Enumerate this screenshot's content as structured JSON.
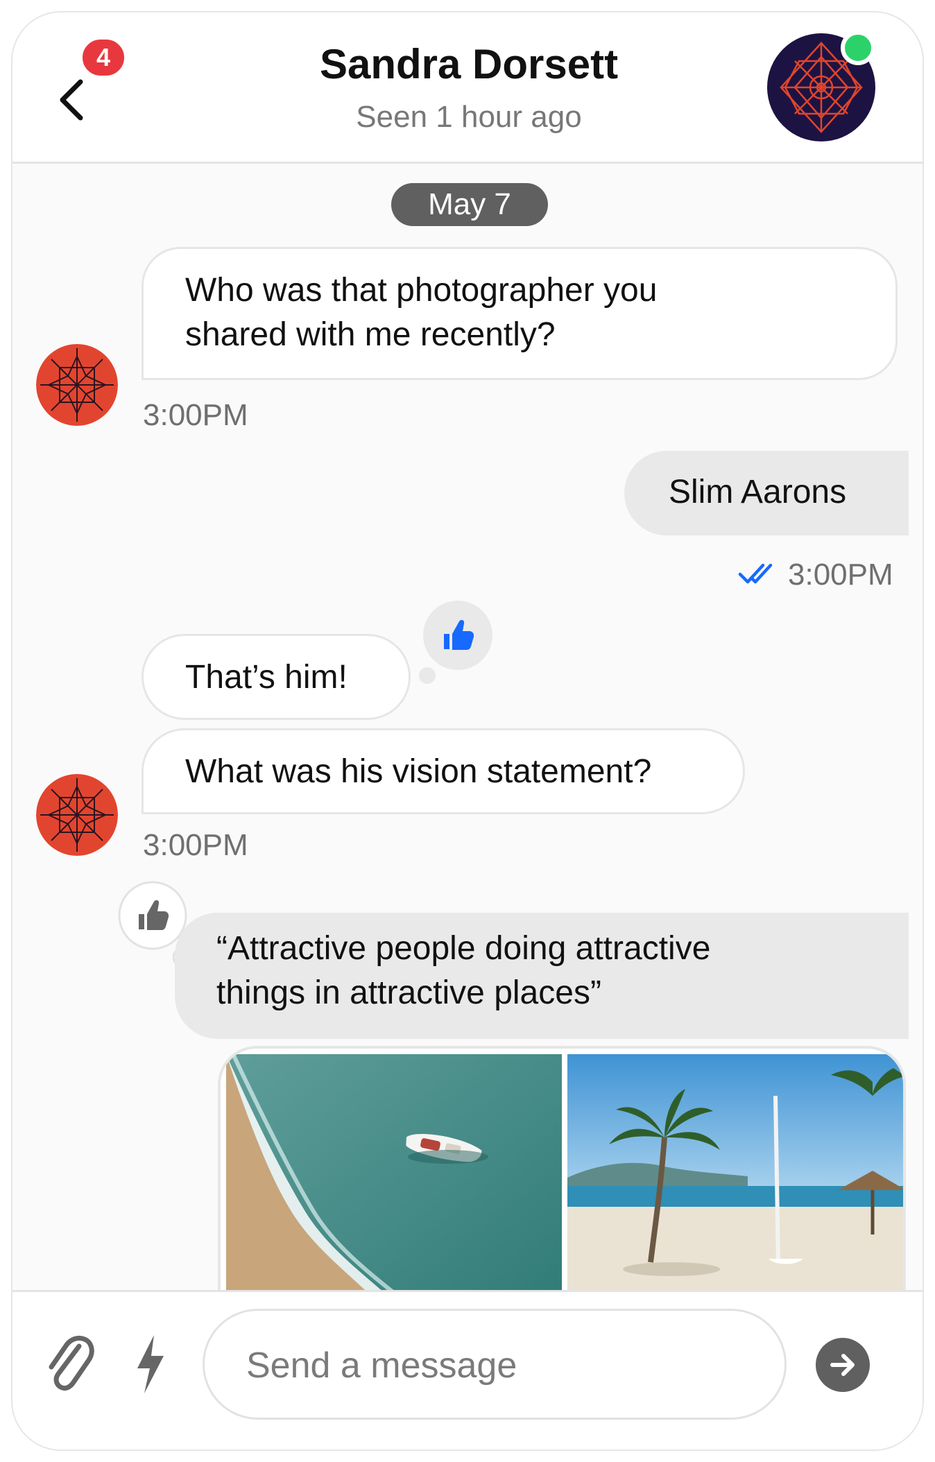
{
  "header": {
    "back_label": "Back",
    "unread_count": "4",
    "contact_name": "Sandra Dorsett",
    "last_seen": "Seen 1 hour ago",
    "online_status_color": "#2bd26a"
  },
  "date_divider": "May 7",
  "messages": [
    {
      "from": "contact",
      "lines": [
        "Who was that photographer you",
        "shared with me recently?"
      ],
      "time": "3:00PM"
    },
    {
      "from": "me",
      "lines": [
        "Slim Aarons"
      ],
      "time": "3:00PM",
      "read_receipt_icon": "double-check-icon"
    },
    {
      "from": "contact",
      "lines": [
        "That’s him!"
      ],
      "reaction_icon": "thumbs-up-icon"
    },
    {
      "from": "contact",
      "lines": [
        "What was his vision statement?"
      ],
      "time": "3:00PM"
    },
    {
      "from": "me",
      "lines": [
        "“Attractive people doing attractive",
        "things in attractive places”"
      ],
      "reaction_icon": "thumbs-up-icon"
    }
  ],
  "photos": [
    {
      "icon": "aerial-beach-boat-photo"
    },
    {
      "icon": "palm-beach-photo"
    }
  ],
  "composer": {
    "placeholder": "Send a message",
    "attach_icon": "paperclip-icon",
    "quick_icon": "bolt-icon",
    "send_icon": "arrow-right-icon"
  },
  "colors": {
    "accent_blue": "#1769ff",
    "badge_red": "#e8383f",
    "avatar_red": "#e2452f"
  }
}
